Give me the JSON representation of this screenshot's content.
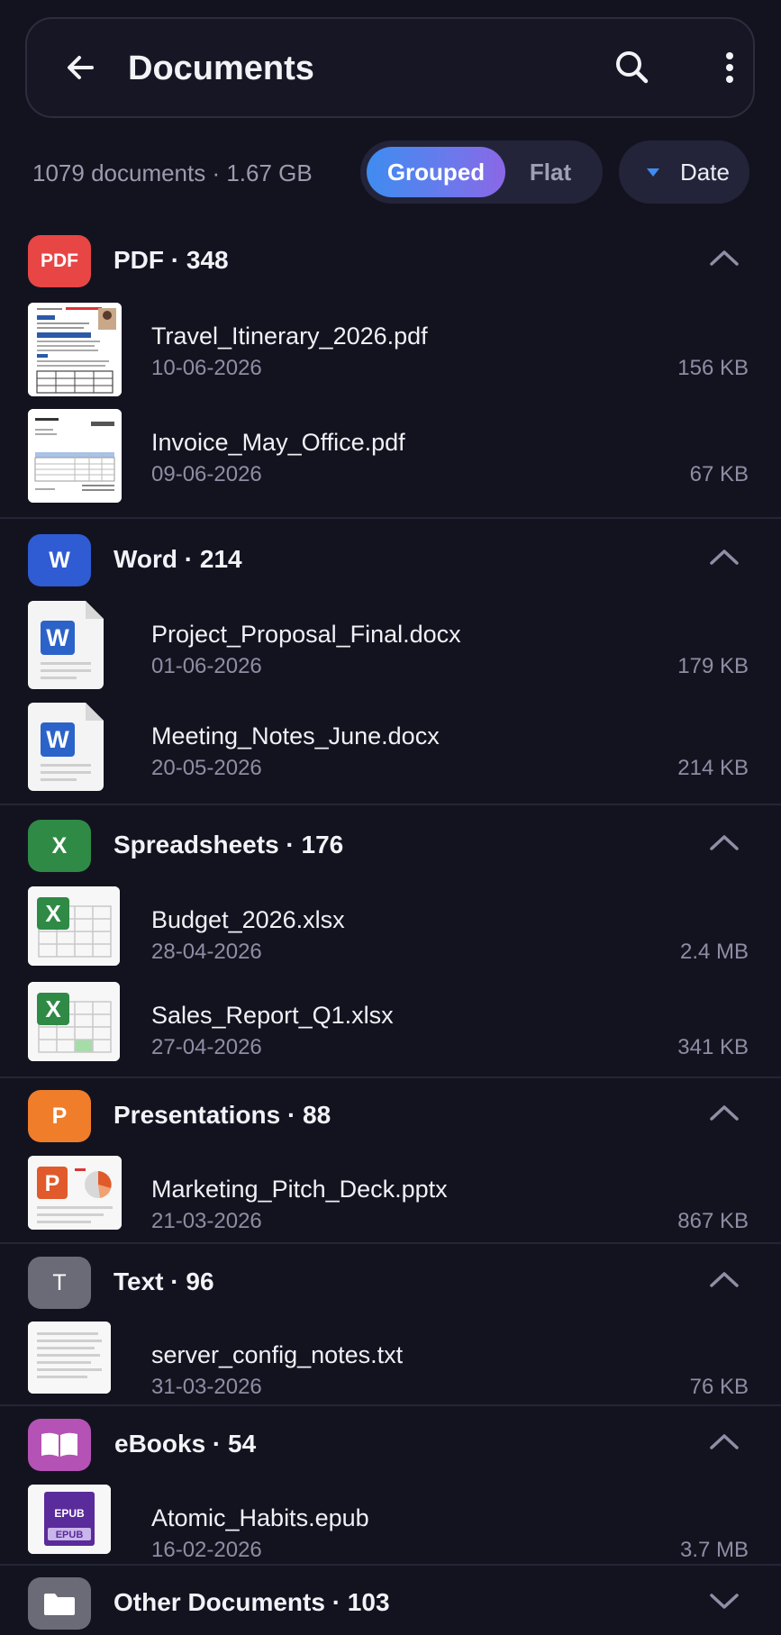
{
  "header": {
    "title": "Documents"
  },
  "summary": "1079 documents · 1.67 GB",
  "view_toggle": {
    "active": "Grouped",
    "inactive": "Flat"
  },
  "sort": {
    "label": "Date"
  },
  "groups": [
    {
      "icon_label": "PDF",
      "label": "PDF · 348",
      "color": "#e84545",
      "files": [
        {
          "name": "Travel_Itinerary_2026.pdf",
          "date": "10-06-2026",
          "size": "156 KB"
        },
        {
          "name": "Invoice_May_Office.pdf",
          "date": "09-06-2026",
          "size": "67 KB"
        }
      ]
    },
    {
      "icon_label": "W",
      "label": "Word · 214",
      "color": "#2f5bd3",
      "files": [
        {
          "name": "Project_Proposal_Final.docx",
          "date": "01-06-2026",
          "size": "179 KB"
        },
        {
          "name": "Meeting_Notes_June.docx",
          "date": "20-05-2026",
          "size": "214 KB"
        }
      ]
    },
    {
      "icon_label": "X",
      "label": "Spreadsheets · 176",
      "color": "#2f8a46",
      "files": [
        {
          "name": "Budget_2026.xlsx",
          "date": "28-04-2026",
          "size": "2.4 MB"
        },
        {
          "name": "Sales_Report_Q1.xlsx",
          "date": "27-04-2026",
          "size": "341 KB"
        }
      ]
    },
    {
      "icon_label": "P",
      "label": "Presentations · 88",
      "color": "#f07d2a",
      "files": [
        {
          "name": "Marketing_Pitch_Deck.pptx",
          "date": "21-03-2026",
          "size": "867 KB"
        }
      ]
    },
    {
      "icon_label": "T",
      "label": "Text · 96",
      "color": "#6b6b78",
      "files": [
        {
          "name": "server_config_notes.txt",
          "date": "31-03-2026",
          "size": "76 KB"
        }
      ]
    },
    {
      "icon": "book-icon",
      "label": "eBooks · 54",
      "color": "#b552b5",
      "files": [
        {
          "name": "Atomic_Habits.epub",
          "date": "16-02-2026",
          "size": "3.7 MB",
          "thumb_label": "EPUB"
        }
      ]
    },
    {
      "icon": "folder-icon",
      "label": "Other Documents · 103",
      "color": "#6b6b78",
      "collapsed": true,
      "files": []
    }
  ]
}
